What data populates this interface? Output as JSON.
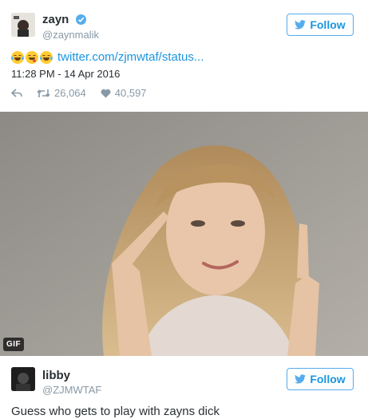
{
  "tweet": {
    "display_name": "zayn",
    "handle": "@zaynmalik",
    "verified": true,
    "follow_label": "Follow",
    "emojis": [
      "joy",
      "yum",
      "joy"
    ],
    "link_text": "twitter.com/zjmwtaf/status...",
    "timestamp": "11:28 PM - 14 Apr 2016",
    "retweets": "26,064",
    "likes": "40,597",
    "media_badge": "GIF"
  },
  "reply_card": {
    "display_name": "libby",
    "handle": "@ZJMWTAF",
    "follow_label": "Follow",
    "text": "Guess who gets to play with zayns dick"
  },
  "colors": {
    "accent": "#55acee",
    "link": "#1b95e0",
    "muted": "#8899a6",
    "text": "#292f33"
  }
}
